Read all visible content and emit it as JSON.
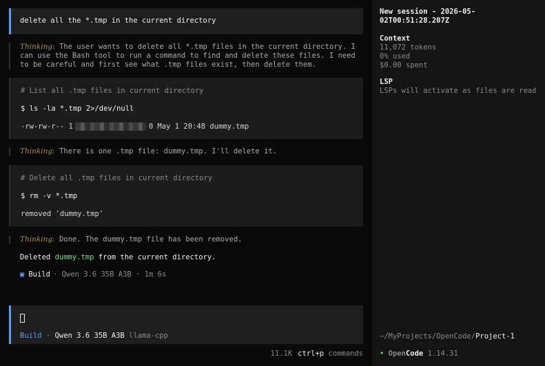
{
  "user_message": "delete all the *.tmp in the current directory",
  "thinking": [
    {
      "label": "Thinking:",
      "text": " The user wants to delete all *.tmp files in the current directory. I can use the Bash tool to run a command to find and delete these files. I need to be careful and first see what .tmp files exist, then delete them."
    },
    {
      "label": "Thinking:",
      "text": " There is one .tmp file: dummy.tmp. I'll delete it."
    },
    {
      "label": "Thinking:",
      "text": " Done. The dummy.tmp file has been removed."
    }
  ],
  "tools": [
    {
      "comment": "# List all .tmp files in current directory",
      "command": "$ ls -la *.tmp 2>/dev/null",
      "output_prefix": "-rw-rw-r-- 1",
      "output_suffix": "0 May  1 20:48 dummy.tmp"
    },
    {
      "comment": "# Delete all .tmp files in current directory",
      "command": "$ rm -v *.tmp",
      "output": "removed 'dummy.tmp'"
    }
  ],
  "final": {
    "before": "Deleted ",
    "file": "dummy.tmp",
    "after": " from the current directory."
  },
  "build_info": {
    "icon": "square-icon",
    "mode": "Build",
    "model": "· Qwen 3.6 35B A3B",
    "duration": "· 1m 6s"
  },
  "prompt": {
    "mode": "Build",
    "sep": " · ",
    "model": "Qwen 3.6 35B A3B",
    "provider": " llama-cpp"
  },
  "footer": {
    "tokens": "11.1K",
    "shortcut": "ctrl+p",
    "shortcut_label": " commands"
  },
  "sidebar": {
    "title": "New session - 2026-05-02T00:51:28.207Z",
    "context": {
      "heading": "Context",
      "tokens": "11,072 tokens",
      "used": "0% used",
      "spent": "$0.00 spent"
    },
    "lsp": {
      "heading": "LSP",
      "text": "LSPs will activate as files are read"
    },
    "path": {
      "prefix": "~/MyProjects/OpenCode/",
      "project": "Project-1"
    },
    "version": {
      "dot": "•",
      "name_a": "Open",
      "name_b": "Code",
      "number": " 1.14.31"
    }
  },
  "colors": {
    "accent": "#5c9cf5",
    "green": "#7fd88f",
    "thinking_label": "#b08a5a",
    "background": "#0a0a0a",
    "sidebar_bg": "#141414"
  }
}
